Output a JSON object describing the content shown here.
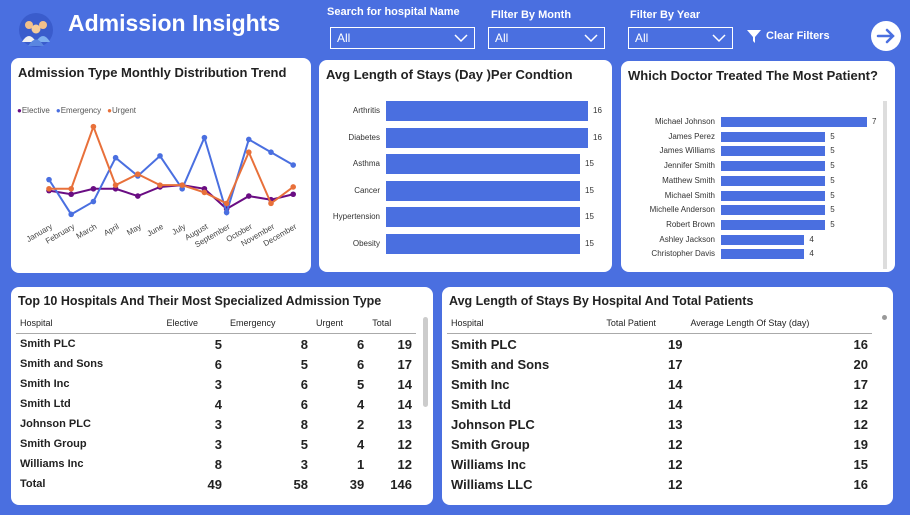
{
  "header": {
    "title": "Admission Insights",
    "search_label": "Search for hospital Name",
    "month_label": "FIlter By Month",
    "year_label": "Filter By Year",
    "search_value": "All",
    "month_value": "All",
    "year_value": "All",
    "clear_label": "Clear Filters"
  },
  "colors": {
    "accent": "#4a6fe0",
    "elective": "#6a0d83",
    "emergency": "#4a6fe0",
    "urgent": "#e8703a"
  },
  "chart_data": [
    {
      "type": "line",
      "title": "Admission Type Monthly Distribution Trend",
      "categories": [
        "January",
        "February",
        "March",
        "April",
        "May",
        "June",
        "July",
        "August",
        "September",
        "October",
        "November",
        "December"
      ],
      "series": [
        {
          "name": "Elective",
          "values": [
            5.5,
            5.3,
            5.6,
            5.6,
            5.2,
            5.7,
            5.8,
            5.6,
            4.5,
            5.2,
            5.0,
            5.3
          ]
        },
        {
          "name": "Emergency",
          "values": [
            6.1,
            4.2,
            4.9,
            7.3,
            6.3,
            7.4,
            5.6,
            8.4,
            4.3,
            8.3,
            7.6,
            6.9
          ]
        },
        {
          "name": "Urgent",
          "values": [
            5.6,
            5.6,
            9.0,
            5.8,
            6.4,
            5.8,
            5.8,
            5.4,
            4.8,
            7.6,
            4.8,
            5.7
          ]
        }
      ]
    },
    {
      "type": "bar",
      "title": "Avg Length of Stays (Day )Per Condtion",
      "categories": [
        "Arthritis",
        "Diabetes",
        "Asthma",
        "Cancer",
        "Hypertension",
        "Obesity"
      ],
      "values": [
        16,
        16,
        15,
        15,
        15,
        15
      ]
    },
    {
      "type": "bar",
      "title": "Which Doctor Treated The Most Patient?",
      "categories": [
        "Michael Johnson",
        "James Perez",
        "James Williams",
        "Jennifer Smith",
        "Matthew Smith",
        "Michael Smith",
        "Michelle Anderson",
        "Robert Brown",
        "Ashley Jackson",
        "Christopher Davis"
      ],
      "values": [
        7,
        5,
        5,
        5,
        5,
        5,
        5,
        5,
        4,
        4
      ]
    }
  ],
  "table1": {
    "title": "Top 10 Hospitals And Their Most Specialized Admission Type",
    "headers": [
      "Hospital",
      "Elective",
      "Emergency",
      "Urgent",
      "Total"
    ],
    "rows": [
      [
        "Smith PLC",
        "5",
        "8",
        "6",
        "19"
      ],
      [
        "Smith and Sons",
        "6",
        "5",
        "6",
        "17"
      ],
      [
        "Smith Inc",
        "3",
        "6",
        "5",
        "14"
      ],
      [
        "Smith Ltd",
        "4",
        "6",
        "4",
        "14"
      ],
      [
        "Johnson PLC",
        "3",
        "8",
        "2",
        "13"
      ],
      [
        "Smith Group",
        "3",
        "5",
        "4",
        "12"
      ],
      [
        "Williams Inc",
        "8",
        "3",
        "1",
        "12"
      ]
    ],
    "total": [
      "Total",
      "49",
      "58",
      "39",
      "146"
    ]
  },
  "table2": {
    "title": "Avg Length of Stays By Hospital And Total Patients",
    "headers": [
      "Hospital",
      "Total Patient",
      "Average Length Of Stay (day)"
    ],
    "rows": [
      [
        "Smith PLC",
        "19",
        "16"
      ],
      [
        "Smith and Sons",
        "17",
        "20"
      ],
      [
        "Smith Inc",
        "14",
        "17"
      ],
      [
        "Smith Ltd",
        "14",
        "12"
      ],
      [
        "Johnson PLC",
        "13",
        "12"
      ],
      [
        "Smith Group",
        "12",
        "19"
      ],
      [
        "Williams Inc",
        "12",
        "15"
      ],
      [
        "Williams LLC",
        "12",
        "16"
      ]
    ]
  }
}
